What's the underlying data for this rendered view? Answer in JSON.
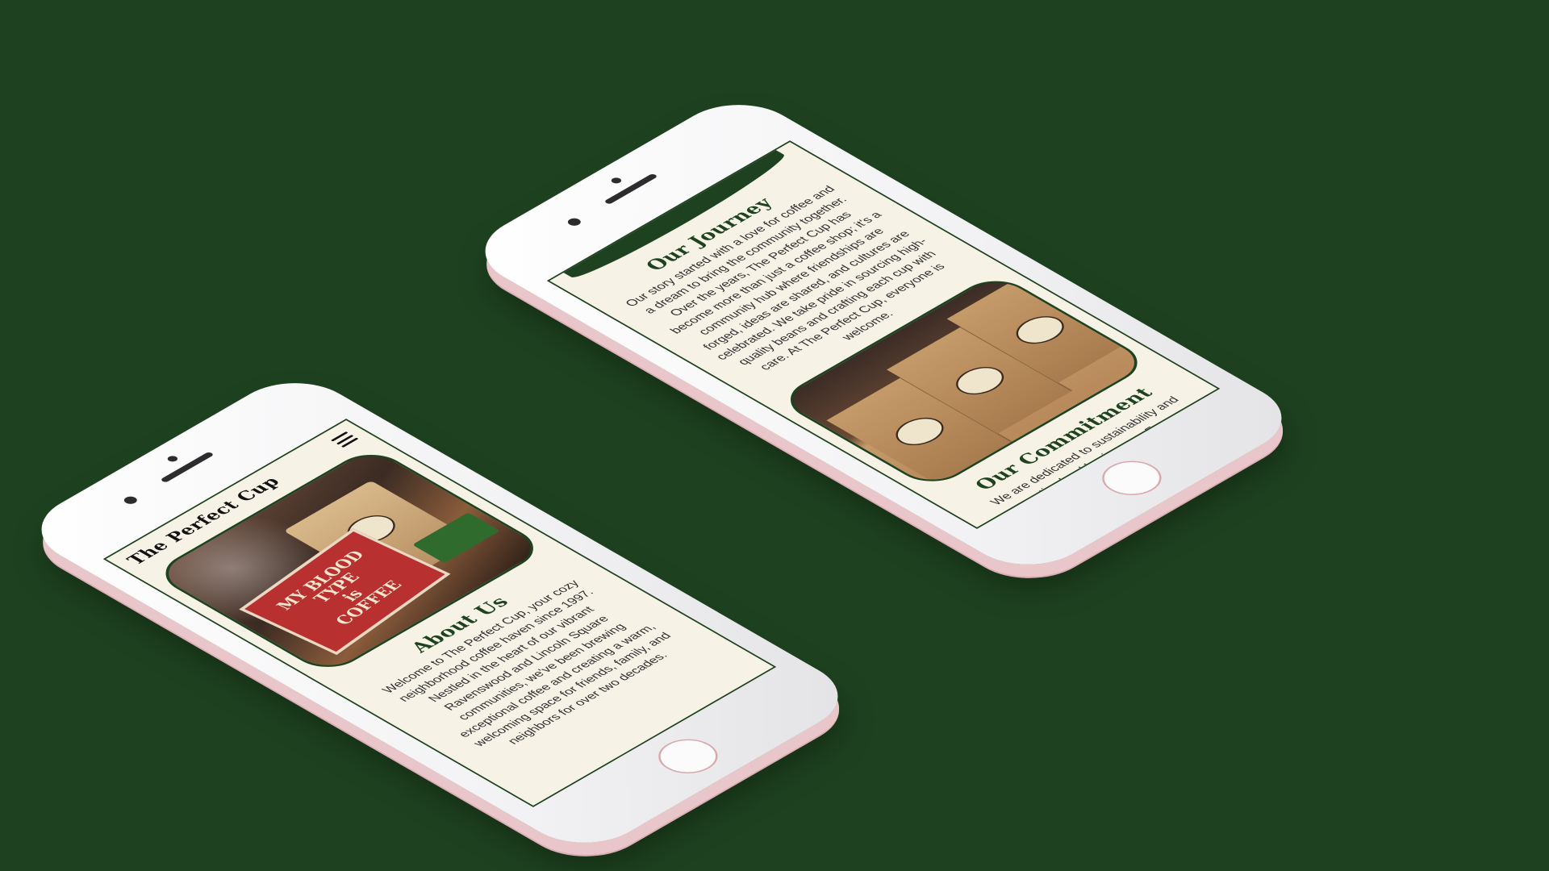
{
  "colors": {
    "background": "#1e4220",
    "site_bg": "#f6f3e6",
    "accent_green": "#1e4220",
    "phone_rose": "#e9c6c9"
  },
  "left_phone": {
    "brand": "The Perfect Cup",
    "menu_icon": "hamburger-icon",
    "photo": {
      "sign_lines": [
        "MY BLOOD",
        "TYPE",
        "is",
        "COFFEE"
      ]
    },
    "about": {
      "title": "About Us",
      "body": "Welcome to The Perfect Cup, your cozy neighborhood coffee haven since 1997. Nestled in the heart of our vibrant Ravenswood and Lincoln Square communities, we've been brewing exceptional coffee and creating a warm, welcoming space for friends, family, and neighbors for over two decades."
    }
  },
  "right_phone": {
    "journey": {
      "title": "Our Journey",
      "body": "Our story started with a love for coffee and a dream to bring the community together. Over the years, The Perfect Cup has become more than just a coffee shop; it's a community hub where friendships are forged, ideas are shared, and cultures are celebrated. We take pride in sourcing high-quality beans and crafting each cup with care. At The Perfect Cup, everyone is welcome."
    },
    "commitment": {
      "title": "Our Commitment",
      "body": "We are dedicated to sustainability and supporting local businesses. From our"
    }
  }
}
